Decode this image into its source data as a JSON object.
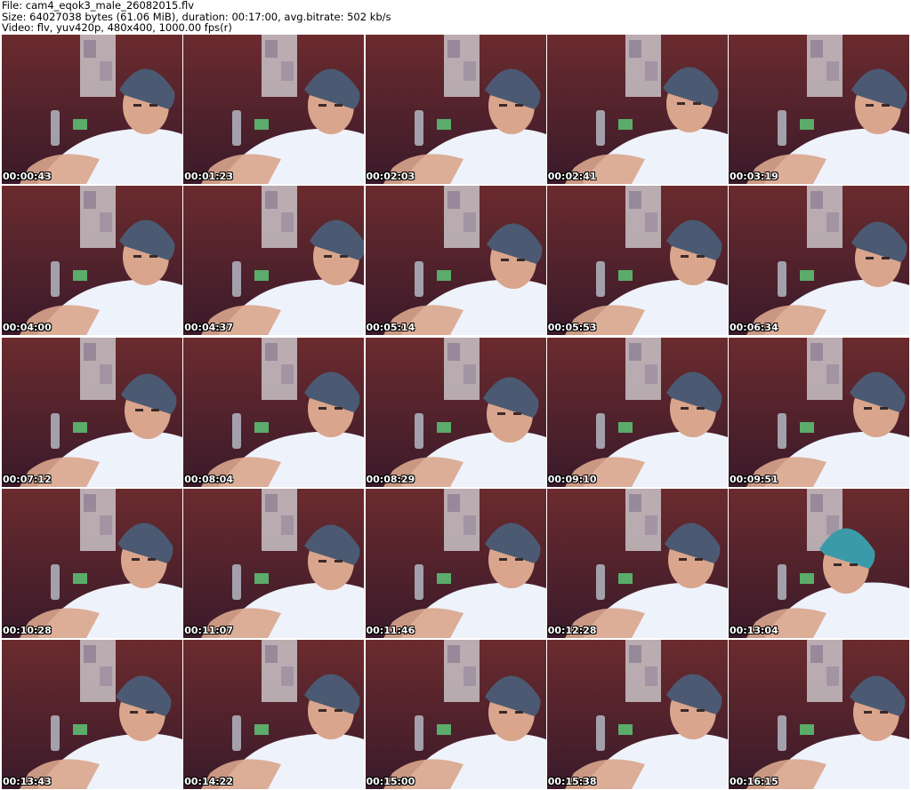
{
  "header": {
    "line1": "File: cam4_eqok3_male_26082015.flv",
    "line2": "Size: 64027038 bytes (61.06 MiB), duration: 00:17:00, avg.bitrate: 502 kb/s",
    "line3": "Video: flv, yuv420p, 480x400, 1000.00 fps(r)"
  },
  "thumbnails": [
    {
      "timestamp": "00:00:43"
    },
    {
      "timestamp": "00:01:23"
    },
    {
      "timestamp": "00:02:03"
    },
    {
      "timestamp": "00:02:41"
    },
    {
      "timestamp": "00:03:19"
    },
    {
      "timestamp": "00:04:00"
    },
    {
      "timestamp": "00:04:37"
    },
    {
      "timestamp": "00:05:14"
    },
    {
      "timestamp": "00:05:53"
    },
    {
      "timestamp": "00:06:34"
    },
    {
      "timestamp": "00:07:12"
    },
    {
      "timestamp": "00:08:04"
    },
    {
      "timestamp": "00:08:29"
    },
    {
      "timestamp": "00:09:10"
    },
    {
      "timestamp": "00:09:51"
    },
    {
      "timestamp": "00:10:28"
    },
    {
      "timestamp": "00:11:07"
    },
    {
      "timestamp": "00:11:46"
    },
    {
      "timestamp": "00:12:28"
    },
    {
      "timestamp": "00:13:04"
    },
    {
      "timestamp": "00:13:43"
    },
    {
      "timestamp": "00:14:22"
    },
    {
      "timestamp": "00:15:00"
    },
    {
      "timestamp": "00:15:38"
    },
    {
      "timestamp": "00:16:15"
    }
  ],
  "colors": {
    "wall": "#6b2b2e",
    "wall_dark": "#3a1a2a",
    "poster": "#c9c3c8",
    "beanie": "#4b5a72",
    "beanie_teal": "#3b9aa8",
    "skin": "#d9a58c",
    "shirt": "#eef2fb",
    "timestamp_text": "#ffffff"
  }
}
